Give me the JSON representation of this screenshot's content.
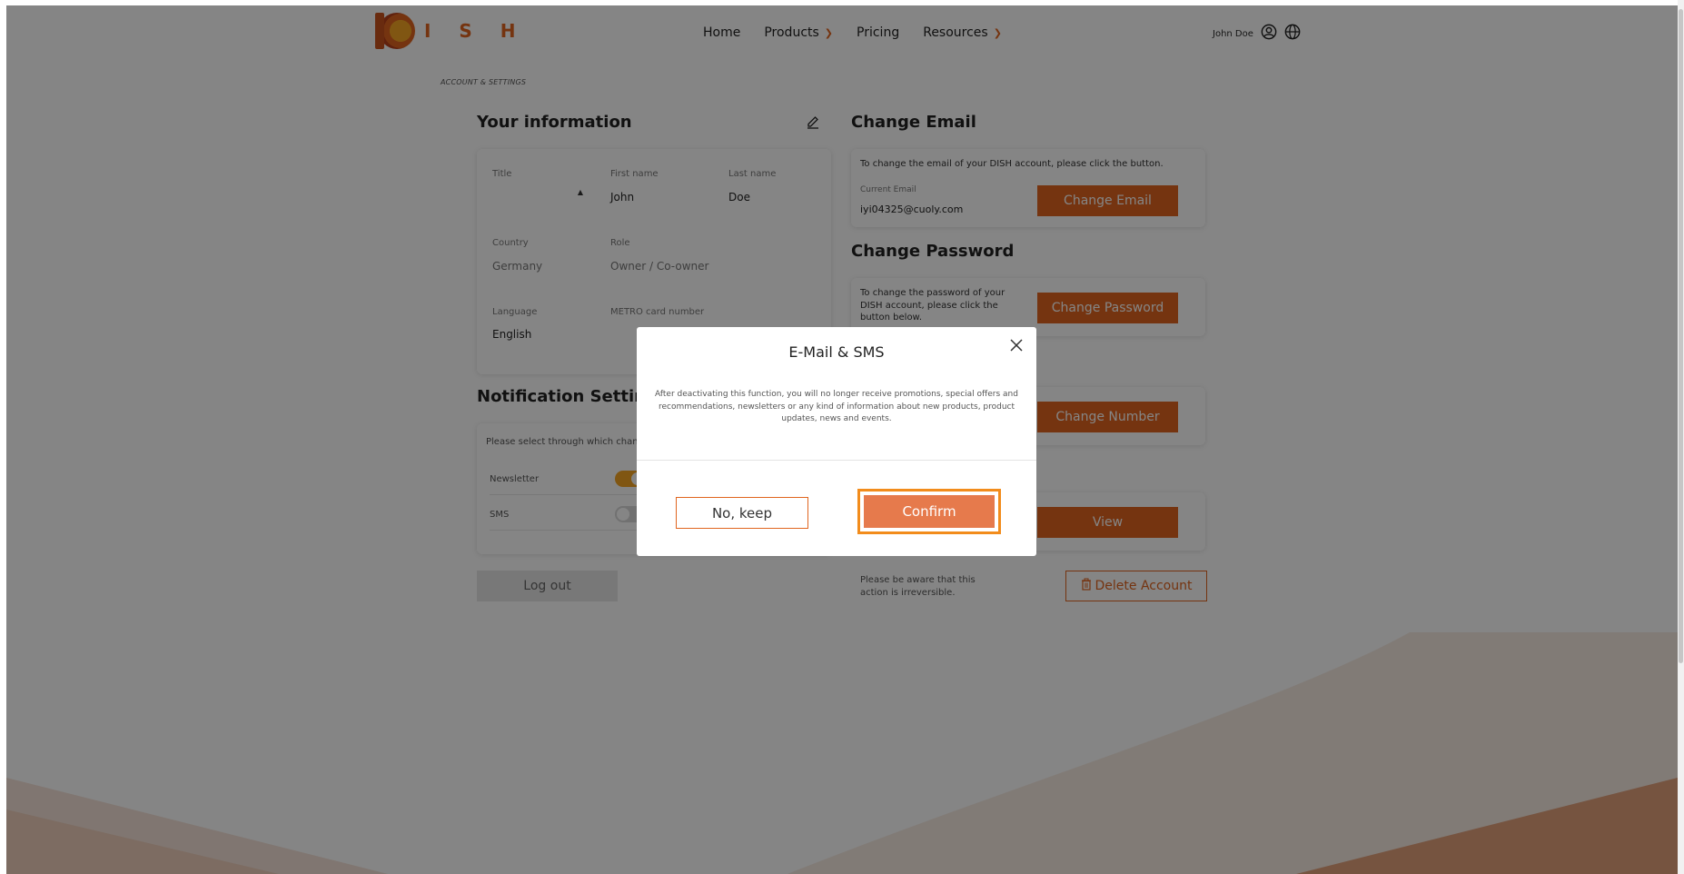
{
  "header": {
    "logo_text": "I S H",
    "nav": [
      {
        "label": "Home",
        "has_chevron": false
      },
      {
        "label": "Products",
        "has_chevron": true
      },
      {
        "label": "Pricing",
        "has_chevron": false
      },
      {
        "label": "Resources",
        "has_chevron": true
      }
    ],
    "user_name": "John Doe",
    "user_icon": "user-circle-icon",
    "language_icon": "globe-icon"
  },
  "breadcrumb": "ACCOUNT & SETTINGS",
  "your_info": {
    "title": "Your information",
    "edit_icon": "pencil-icon",
    "title_label": "Title",
    "first_name_label": "First name",
    "first_name": "John",
    "last_name_label": "Last name",
    "last_name": "Doe",
    "country_label": "Country",
    "country": "Germany",
    "role_label": "Role",
    "role": "Owner / Co-owner",
    "language_label": "Language",
    "language": "English",
    "metro_label": "METRO card number"
  },
  "notifications": {
    "title": "Notification Settings",
    "description": "Please select through which channel",
    "items": [
      {
        "label": "Newsletter",
        "on": true
      },
      {
        "label": "SMS",
        "on": false
      }
    ]
  },
  "logout_label": "Log out",
  "change_email": {
    "title": "Change Email",
    "description": "To change the email of your DISH account, please click the button.",
    "current_label": "Current Email",
    "current_value": "iyi04325@cuoly.com",
    "button": "Change Email"
  },
  "change_password": {
    "title": "Change Password",
    "description": "To change the password of your DISH account, please click the button below.",
    "button": "Change Password"
  },
  "change_number": {
    "button": "Change Number"
  },
  "view": {
    "button": "View"
  },
  "delete": {
    "note": "Please be aware that this action is irreversible.",
    "button": "Delete Account",
    "icon": "trash-icon"
  },
  "modal": {
    "title": "E-Mail & SMS",
    "body": "After deactivating this function, you will no longer receive promotions, special offers and recommendations, newsletters or any kind of information about new products, product updates, news and events.",
    "keep_label": "No, keep",
    "confirm_label": "Confirm",
    "close_icon": "close-icon"
  },
  "colors": {
    "accent": "#e0651f",
    "confirm": "#e67a4c",
    "focus_ring": "#f28c1c",
    "wave": "#f6e3d8"
  }
}
